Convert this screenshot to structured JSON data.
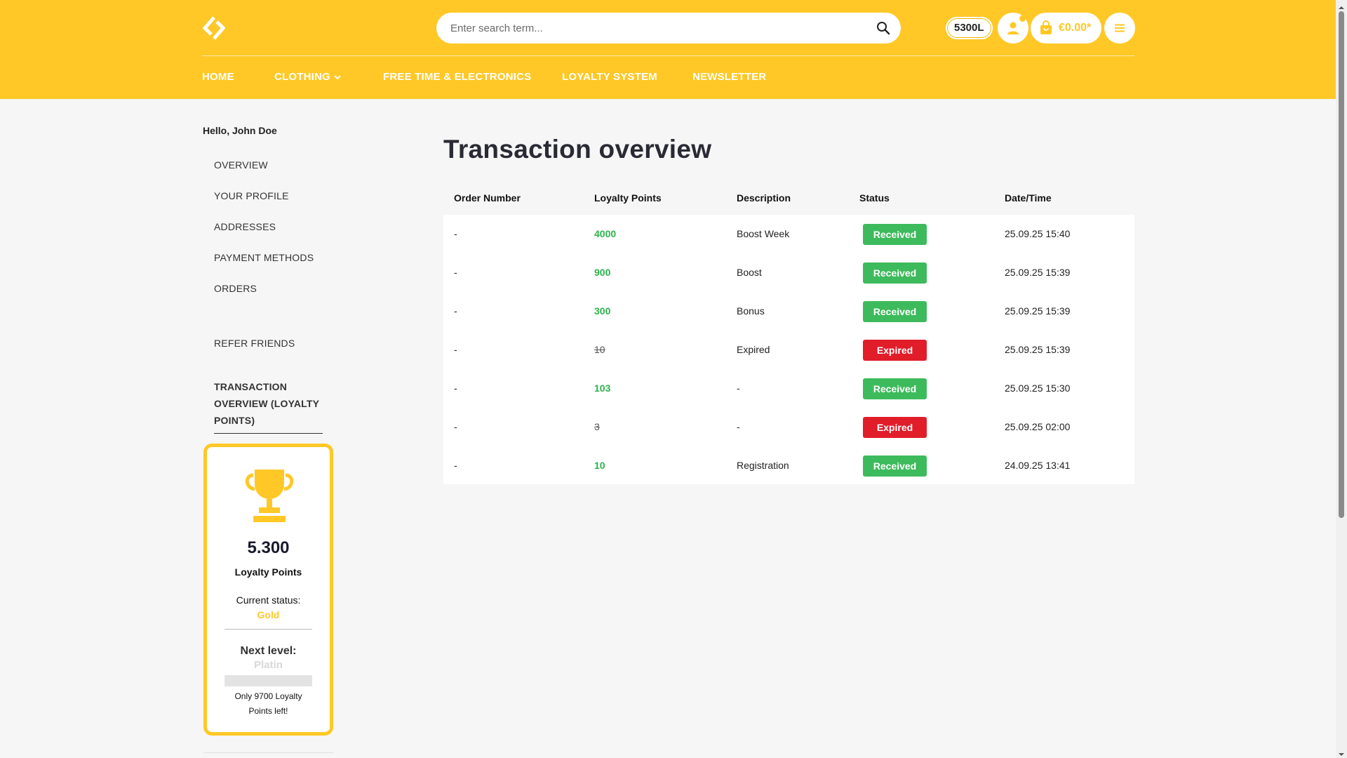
{
  "header": {
    "logo_icon": "logo-mark-icon",
    "search_placeholder": "Enter search term...",
    "points_badge": "5300L",
    "cart_total": "€0.00*",
    "brand_color": "#ffc826"
  },
  "nav": {
    "items": [
      {
        "label": "HOME"
      },
      {
        "label": "CLOTHING",
        "has_dropdown": true
      },
      {
        "label": "FREE TIME & ELECTRONICS"
      },
      {
        "label": "LOYALTY SYSTEM"
      },
      {
        "label": "NEWSLETTER"
      }
    ]
  },
  "sidebar": {
    "greeting": "Hello, John Doe",
    "links": [
      {
        "label": "OVERVIEW"
      },
      {
        "label": "YOUR PROFILE"
      },
      {
        "label": "ADDRESSES"
      },
      {
        "label": "PAYMENT METHODS"
      },
      {
        "label": "ORDERS"
      },
      {
        "label": "REFER FRIENDS"
      }
    ],
    "active": "TRANSACTION OVERVIEW (LOYALTY POINTS)"
  },
  "loyalty_card": {
    "icon": "trophy-icon",
    "points": "5.300",
    "points_label": "Loyalty Points",
    "status_label": "Current status:",
    "status": "Gold",
    "next_label": "Next level:",
    "next_level": "Platin",
    "progress_fraction": 0.0,
    "points_left_text": "Only 9700 Loyalty Points left!"
  },
  "main": {
    "title": "Transaction overview",
    "columns": [
      "Order Number",
      "Loyalty Points",
      "Description",
      "Status",
      "Date/Time"
    ],
    "rows": [
      {
        "order": "-",
        "points": "4000",
        "description": "Boost Week",
        "status": "Received",
        "datetime": "25.09.25 15:40"
      },
      {
        "order": "-",
        "points": "900",
        "description": "Boost",
        "status": "Received",
        "datetime": "25.09.25 15:39"
      },
      {
        "order": "-",
        "points": "300",
        "description": "Bonus",
        "status": "Received",
        "datetime": "25.09.25 15:39"
      },
      {
        "order": "-",
        "points": "10",
        "description": "Expired",
        "status": "Expired",
        "datetime": "25.09.25 15:39"
      },
      {
        "order": "-",
        "points": "103",
        "description": "-",
        "status": "Received",
        "datetime": "25.09.25 15:30"
      },
      {
        "order": "-",
        "points": "3",
        "description": "-",
        "status": "Expired",
        "datetime": "25.09.25 02:00"
      },
      {
        "order": "-",
        "points": "10",
        "description": "Registration",
        "status": "Received",
        "datetime": "24.09.25 13:41"
      }
    ],
    "status_colors": {
      "Received": "#3dbb5c",
      "Expired": "#e11d2a"
    }
  }
}
